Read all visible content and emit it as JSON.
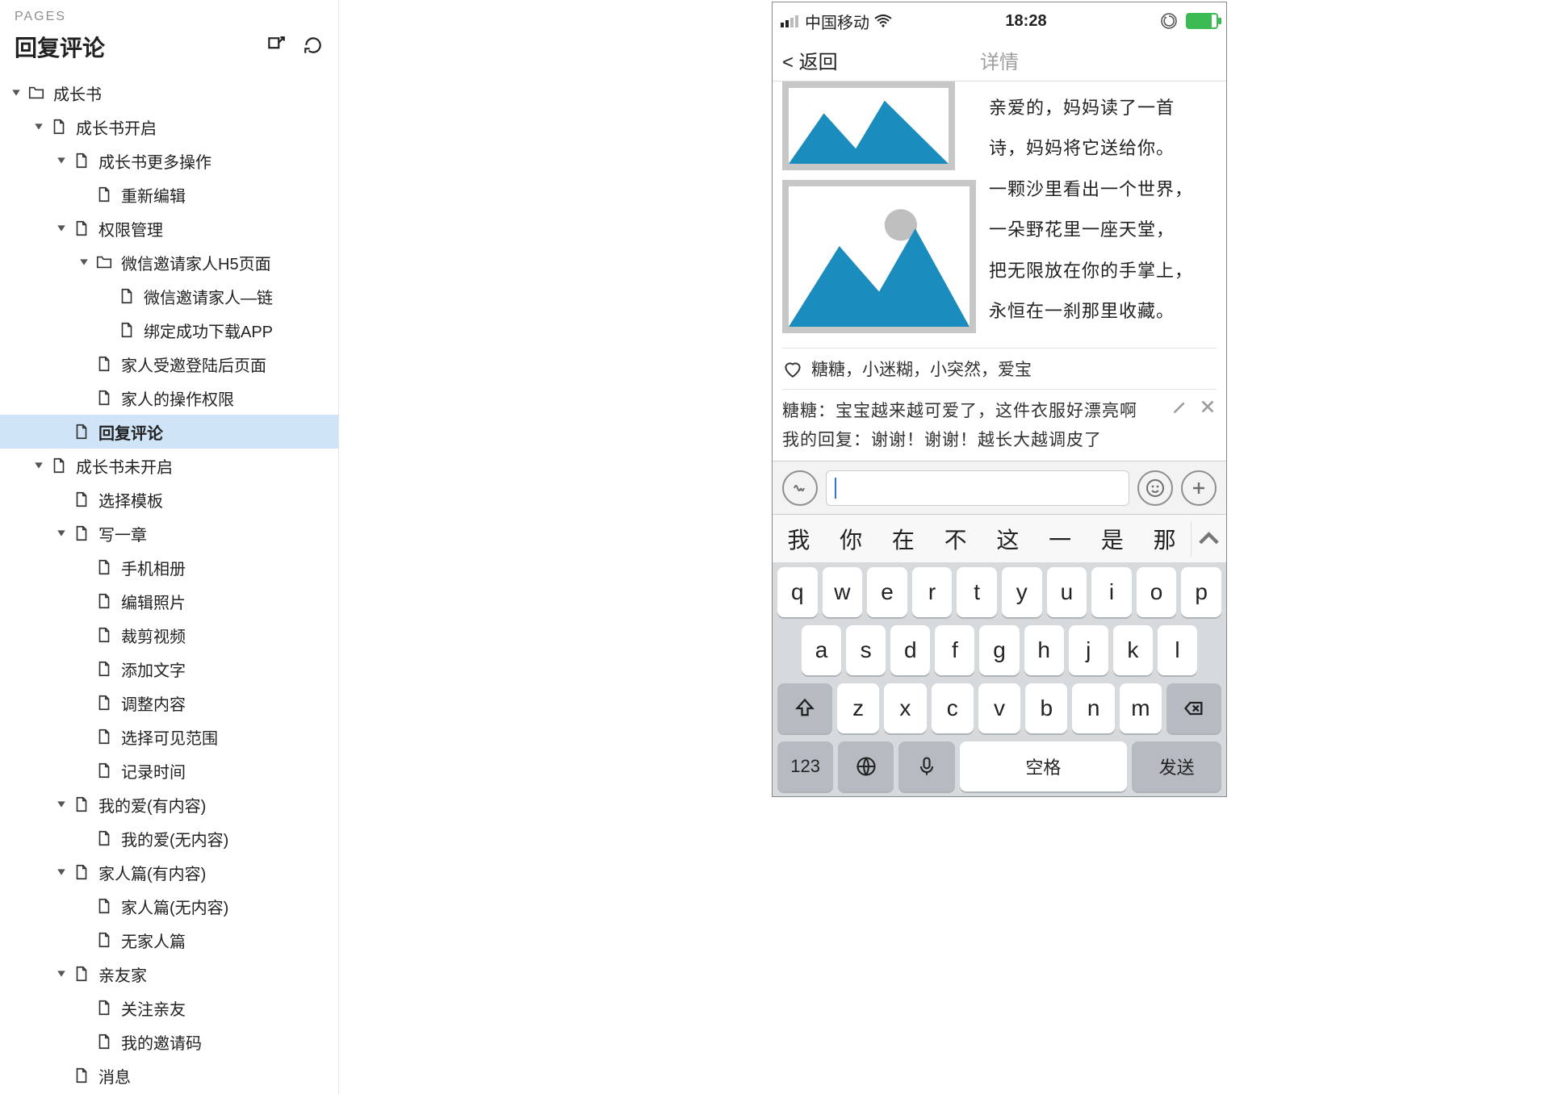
{
  "sidebar": {
    "section_label": "PAGES",
    "title": "回复评论",
    "tree": [
      {
        "depth": 0,
        "caret": "down",
        "icon": "folder",
        "label": "成长书"
      },
      {
        "depth": 1,
        "caret": "down",
        "icon": "file",
        "label": "成长书开启"
      },
      {
        "depth": 2,
        "caret": "down",
        "icon": "file",
        "label": "成长书更多操作"
      },
      {
        "depth": 3,
        "caret": "none",
        "icon": "file",
        "label": "重新编辑"
      },
      {
        "depth": 2,
        "caret": "down",
        "icon": "file",
        "label": "权限管理"
      },
      {
        "depth": 3,
        "caret": "down",
        "icon": "folder",
        "label": "微信邀请家人H5页面"
      },
      {
        "depth": 4,
        "caret": "none",
        "icon": "file",
        "label": "微信邀请家人—链"
      },
      {
        "depth": 4,
        "caret": "none",
        "icon": "file",
        "label": "绑定成功下载APP"
      },
      {
        "depth": 3,
        "caret": "none",
        "icon": "file",
        "label": "家人受邀登陆后页面"
      },
      {
        "depth": 3,
        "caret": "none",
        "icon": "file",
        "label": "家人的操作权限"
      },
      {
        "depth": 2,
        "caret": "none",
        "icon": "file",
        "label": "回复评论",
        "selected": true
      },
      {
        "depth": 1,
        "caret": "down",
        "icon": "file",
        "label": "成长书未开启"
      },
      {
        "depth": 2,
        "caret": "none",
        "icon": "file",
        "label": "选择模板"
      },
      {
        "depth": 2,
        "caret": "down",
        "icon": "file",
        "label": "写一章"
      },
      {
        "depth": 3,
        "caret": "none",
        "icon": "file",
        "label": "手机相册"
      },
      {
        "depth": 3,
        "caret": "none",
        "icon": "file",
        "label": "编辑照片"
      },
      {
        "depth": 3,
        "caret": "none",
        "icon": "file",
        "label": "裁剪视频"
      },
      {
        "depth": 3,
        "caret": "none",
        "icon": "file",
        "label": "添加文字"
      },
      {
        "depth": 3,
        "caret": "none",
        "icon": "file",
        "label": "调整内容"
      },
      {
        "depth": 3,
        "caret": "none",
        "icon": "file",
        "label": "选择可见范围"
      },
      {
        "depth": 3,
        "caret": "none",
        "icon": "file",
        "label": "记录时间"
      },
      {
        "depth": 2,
        "caret": "down",
        "icon": "file",
        "label": "我的爱(有内容)"
      },
      {
        "depth": 3,
        "caret": "none",
        "icon": "file",
        "label": "我的爱(无内容)"
      },
      {
        "depth": 2,
        "caret": "down",
        "icon": "file",
        "label": "家人篇(有内容)"
      },
      {
        "depth": 3,
        "caret": "none",
        "icon": "file",
        "label": "家人篇(无内容)"
      },
      {
        "depth": 3,
        "caret": "none",
        "icon": "file",
        "label": "无家人篇"
      },
      {
        "depth": 2,
        "caret": "down",
        "icon": "file",
        "label": "亲友家"
      },
      {
        "depth": 3,
        "caret": "none",
        "icon": "file",
        "label": "关注亲友"
      },
      {
        "depth": 3,
        "caret": "none",
        "icon": "file",
        "label": "我的邀请码"
      },
      {
        "depth": 2,
        "caret": "none",
        "icon": "file",
        "label": "消息"
      }
    ]
  },
  "phone": {
    "status": {
      "carrier": "中国移动",
      "time": "18:28"
    },
    "nav": {
      "back": "< 返回",
      "title": "详情"
    },
    "poem": {
      "l1": "亲爱的，妈妈读了一首",
      "l2": "诗，妈妈将它送给你。",
      "l3": "一颗沙里看出一个世界，",
      "l4": "一朵野花里一座天堂，",
      "l5": "把无限放在你的手掌上，",
      "l6": "永恒在一刹那里收藏。"
    },
    "likes": "糖糖，小迷糊，小突然，爱宝",
    "comments": {
      "c1": "糖糖：宝宝越来越可爱了，这件衣服好漂亮啊",
      "reply": "我的回复：谢谢！谢谢！越长大越调皮了"
    },
    "candidates": [
      "我",
      "你",
      "在",
      "不",
      "这",
      "一",
      "是",
      "那"
    ],
    "keyboard": {
      "row1": [
        "q",
        "w",
        "e",
        "r",
        "t",
        "y",
        "u",
        "i",
        "o",
        "p"
      ],
      "row2": [
        "a",
        "s",
        "d",
        "f",
        "g",
        "h",
        "j",
        "k",
        "l"
      ],
      "row3": [
        "z",
        "x",
        "c",
        "v",
        "b",
        "n",
        "m"
      ],
      "numeric_label": "123",
      "space_label": "空格",
      "send_label": "发送"
    }
  }
}
